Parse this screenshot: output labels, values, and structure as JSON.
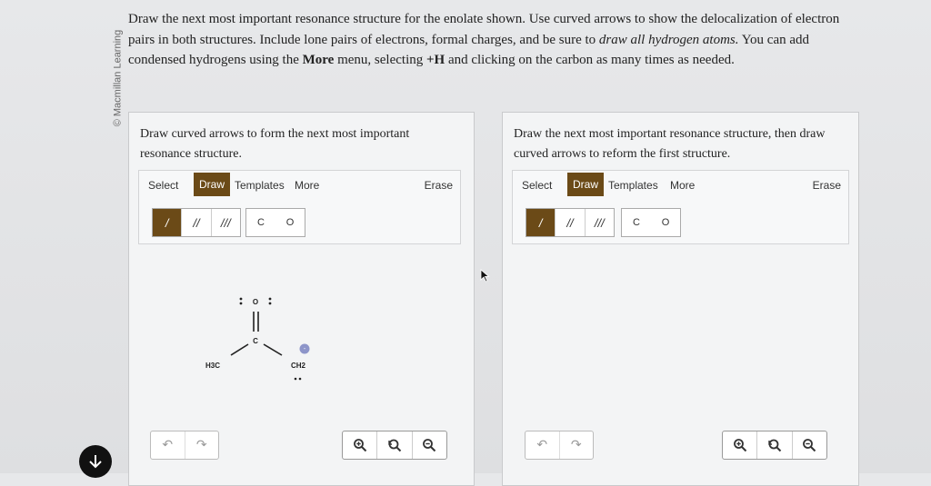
{
  "side_credit": "© Macmillan Learning",
  "instructions": {
    "part1": "Draw the next most important resonance structure for the enolate shown. Use curved arrows to show the delocalization of electron pairs in both structures. Include lone pairs of electrons, formal charges, and be sure to ",
    "italic": "draw all hydrogen atoms.",
    "part2": " You can add condensed hydrogens using the ",
    "bold1": "More",
    "part3": " menu, selecting ",
    "bold2": "+H",
    "part4": " and clicking on the carbon as many times as needed."
  },
  "left_panel": {
    "prompt": "Draw curved arrows to form the next most important resonance structure.",
    "toolbar": {
      "select": "Select",
      "draw": "Draw",
      "templates": "Templates",
      "more": "More",
      "erase": "Erase"
    },
    "bonds": [
      "/",
      "//",
      "///"
    ],
    "atoms": [
      "C",
      "O"
    ],
    "molecule": {
      "oxygen": "O",
      "carbon": "C",
      "left_group": "H3C",
      "right_group": "CH2",
      "charge": "-"
    }
  },
  "right_panel": {
    "prompt": "Draw the next most important resonance structure, then draw curved arrows to reform the first structure.",
    "toolbar": {
      "select": "Select",
      "draw": "Draw",
      "templates": "Templates",
      "more": "More",
      "erase": "Erase"
    },
    "bonds": [
      "/",
      "//",
      "///"
    ],
    "atoms": [
      "C",
      "O"
    ]
  },
  "colors": {
    "accent": "#6b4a17",
    "charge": "#8d95c9"
  },
  "icons": [
    "undo-icon",
    "redo-icon",
    "zoom-in-icon",
    "zoom-reset-icon",
    "zoom-out-icon",
    "cursor-icon",
    "down-arrow-icon"
  ]
}
